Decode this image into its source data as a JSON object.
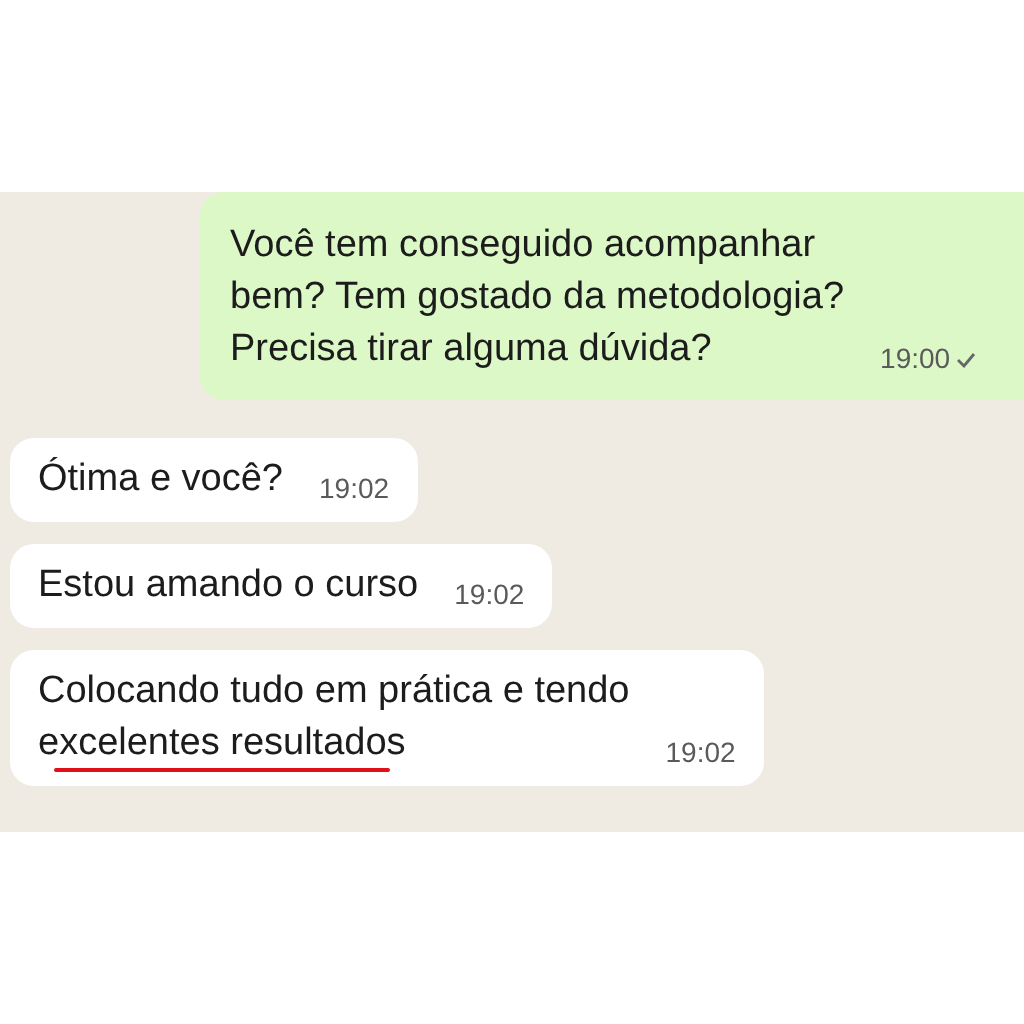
{
  "messages": [
    {
      "kind": "outgoing",
      "lines": [
        {
          "text": "Você tem conseguido acompanhar",
          "underlined": false
        },
        {
          "text": "bem? Tem gostado da metodologia?",
          "underlined": false
        },
        {
          "text": "Precisa tirar alguma dúvida?",
          "underlined": false
        }
      ],
      "time": "19:00",
      "sent": true
    },
    {
      "kind": "incoming",
      "lines": [
        {
          "text": "Ótima e você?",
          "underlined": false
        }
      ],
      "time": "19:02"
    },
    {
      "kind": "incoming",
      "lines": [
        {
          "text": "Estou amando o curso",
          "underlined": false
        }
      ],
      "time": "19:02"
    },
    {
      "kind": "incoming",
      "lines": [
        {
          "text": "Colocando tudo em prática e tendo",
          "underlined": false
        },
        {
          "text": "excelentes resultados",
          "underlined": true
        }
      ],
      "time": "19:02"
    }
  ]
}
